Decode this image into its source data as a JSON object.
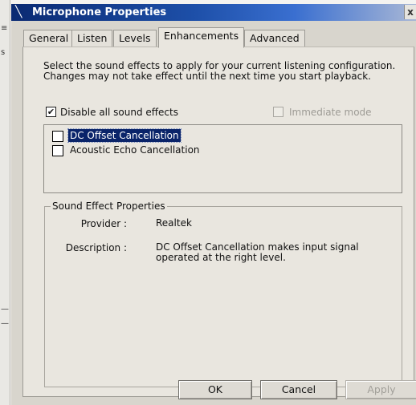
{
  "window": {
    "title": "Microphone Properties",
    "close_label": "x"
  },
  "tabs": [
    {
      "label": "General",
      "active": false
    },
    {
      "label": "Listen",
      "active": false
    },
    {
      "label": "Levels",
      "active": false
    },
    {
      "label": "Enhancements",
      "active": true
    },
    {
      "label": "Advanced",
      "active": false
    }
  ],
  "enhancements": {
    "description": "Select the sound effects to apply for your current listening configuration. Changes may not take effect until the next time you start playback.",
    "disable_all": {
      "label": "Disable all sound effects",
      "checked": true
    },
    "immediate_mode": {
      "label": "Immediate mode",
      "checked": false,
      "enabled": false
    },
    "effects": [
      {
        "label": "DC Offset Cancellation",
        "checked": false,
        "selected": true
      },
      {
        "label": "Acoustic Echo Cancellation",
        "checked": false,
        "selected": false
      }
    ],
    "properties": {
      "legend": "Sound Effect Properties",
      "provider_label": "Provider :",
      "provider_value": "Realtek",
      "description_label": "Description :",
      "description_value": "DC Offset Cancellation makes input signal operated at the right level."
    }
  },
  "buttons": {
    "ok": "OK",
    "cancel": "Cancel",
    "apply": "Apply",
    "apply_enabled": false
  },
  "colors": {
    "titlebar": "#0a2a72",
    "selection": "#0a246a",
    "dialog_bg": "#d8d5cd",
    "panel_bg": "#e9e6df"
  },
  "icons": {
    "title_icon": "microphone-icon",
    "pointer": "mouse-pointer-icon",
    "check": "✔"
  }
}
